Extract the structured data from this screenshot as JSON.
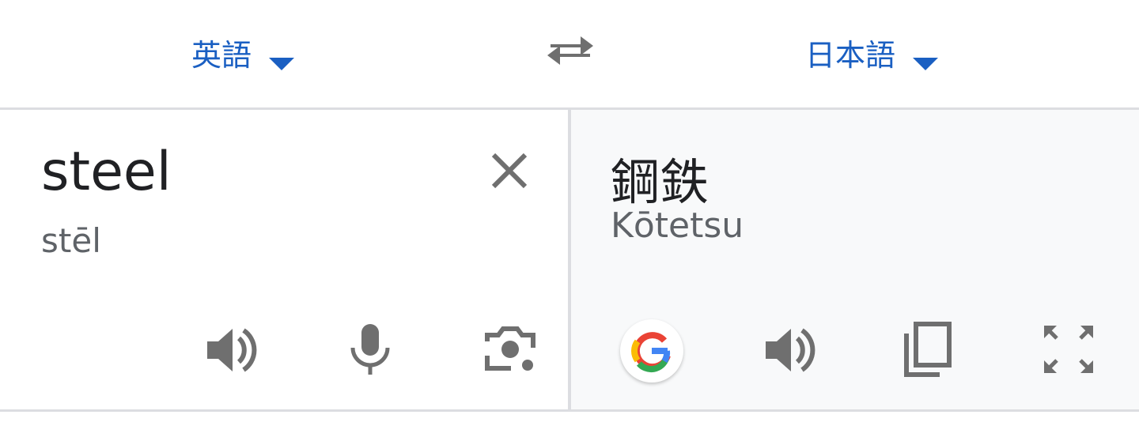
{
  "language_bar": {
    "source_language": "英語",
    "target_language": "日本語"
  },
  "source": {
    "text": "steel",
    "pronunciation": "stēl"
  },
  "translation": {
    "text": "鋼鉄",
    "romanization": "Kōtetsu"
  },
  "icons": {
    "source_dropdown": "caret-down-icon",
    "swap": "swap-arrows-icon",
    "target_dropdown": "caret-down-icon",
    "clear": "close-icon",
    "source_listen": "speaker-icon",
    "microphone": "microphone-icon",
    "camera": "camera-lens-icon",
    "google": "google-logo-icon",
    "target_listen": "speaker-icon",
    "copy": "copy-icon",
    "fullscreen": "fullscreen-icon"
  },
  "colors": {
    "accent": "#1a5fc2",
    "icon_gray": "#6f6f6f",
    "divider": "#dcdde1",
    "translation_bg": "#f8f9fa"
  }
}
